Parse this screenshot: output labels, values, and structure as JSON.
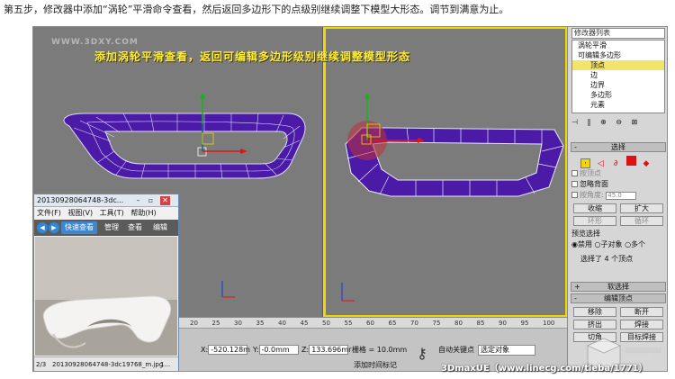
{
  "caption": "第五步，修改器中添加“涡轮”平滑命令查看，然后返回多边形下的点级别继续调整下模型大形态。调节到满意为止。",
  "viewport": {
    "banner": "添加涡轮平滑查看，返回可编辑多边形级别继续调整模型形态",
    "watermark": "WWW.3DXY.COM"
  },
  "command_panel": {
    "modifier_list": "修改器列表",
    "stack": [
      "涡轮平滑",
      "可编辑多边形",
      "顶点",
      "边",
      "边界",
      "多边形",
      "元素"
    ],
    "selection_rollout": "选择",
    "by_vertex": "按顶点",
    "ignore_backfacing": "忽略背面",
    "by_angle": "按角度:",
    "angle_value": "45.0",
    "shrink": "收缩",
    "grow": "扩大",
    "ring": "环形",
    "loop": "循环",
    "preview_selection": "预览选择",
    "preview_options": [
      "禁用",
      "子对象",
      "多个"
    ],
    "selection_info": "选择了 4 个顶点",
    "soft_selection": "软选择",
    "edit_vertices": "编辑顶点",
    "remove": "移除",
    "break": "断开",
    "extrude": "挤出",
    "weld": "焊接",
    "chamfer": "切角",
    "target_weld": "目标焊接"
  },
  "statusbar": {
    "ruler_ticks": [
      "20",
      "25",
      "30",
      "35",
      "40",
      "45",
      "50",
      "55",
      "60",
      "65",
      "70",
      "75",
      "80",
      "85",
      "90",
      "95",
      "100"
    ],
    "x_label": "X:",
    "x_value": "-520.128m",
    "y_label": "Y:",
    "y_value": "-0.0mm",
    "z_label": "Z:",
    "z_value": "133.696mr",
    "grid": "栅格 = 10.0mm",
    "auto_key": "自动关键点",
    "selected_object": "选定对象",
    "add_time_tag": "添加时间标记"
  },
  "viewer": {
    "title": "20130928064748-3dc...",
    "menu": [
      "文件(F)",
      "视图(V)",
      "工具(T)",
      "帮助(H)"
    ],
    "quick_view": "快速查看",
    "toolbar": [
      "管理",
      "查看",
      "编辑"
    ],
    "status_index": "2/3",
    "status_file": "20130928064748-3dc19768_m.jpg",
    "status_extra": "1..."
  },
  "footer_watermark": "3DmaxUE（www.linecg.com/tieba/1771）",
  "colors": {
    "mesh_fill": "#4b1aa6",
    "mesh_edge": "#e8e8ff",
    "banner_text": "#ffef3a",
    "viewport_bg": "#7b7b7b",
    "active_border": "#f2d600",
    "selection_highlight": "#f2e36a",
    "axis_x": "#e11414",
    "axis_y": "#16b516",
    "axis_z": "#1c32d8"
  }
}
